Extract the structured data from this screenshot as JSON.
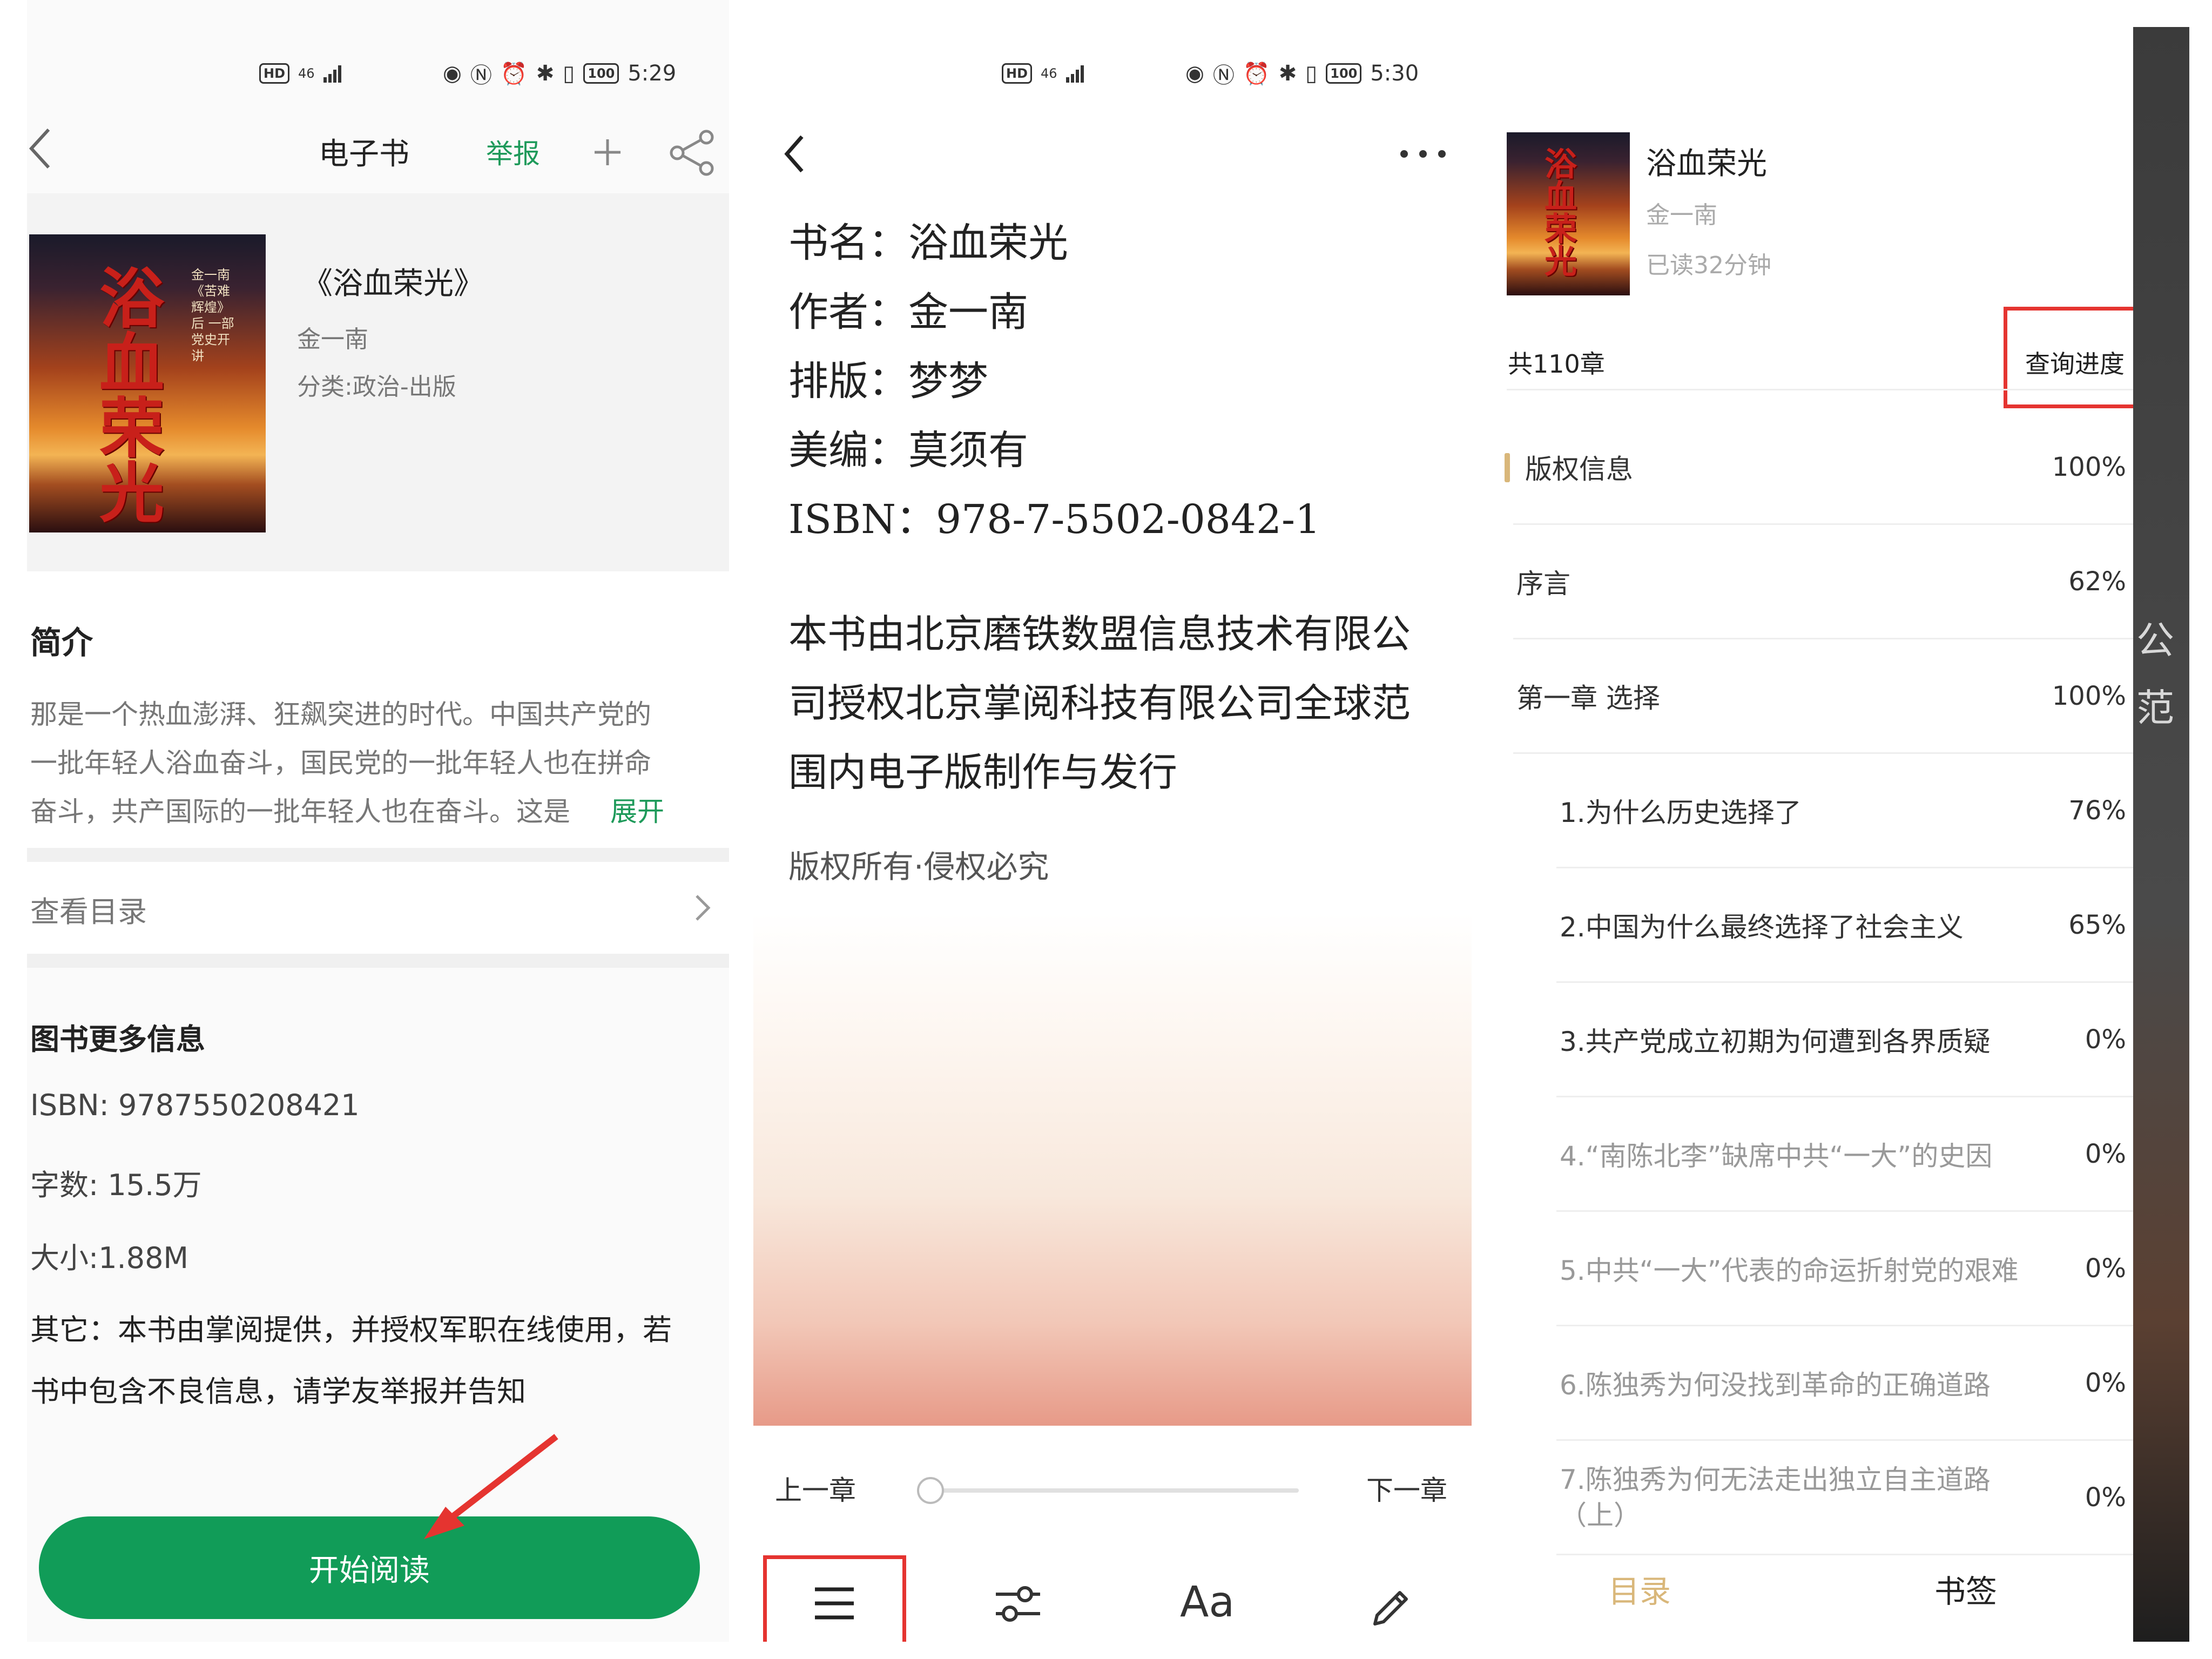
{
  "status_bar_1": {
    "hd": "HD",
    "net": "46",
    "battery": "100",
    "time": "5:29"
  },
  "status_bar_2": {
    "hd": "HD",
    "net": "46",
    "battery": "100",
    "time": "5:30"
  },
  "detail": {
    "title": "电子书",
    "report": "举报",
    "book_title": "《浴血荣光》",
    "author": "金一南",
    "category": "分类:政治-出版",
    "cover_title": "浴血荣光",
    "cover_subtitle": "金一南《苦难辉煌》后 一部党史开讲",
    "intro_heading": "简介",
    "intro_text_1": "那是一个热血澎湃、狂飙突进的时代。中国共产党的",
    "intro_text_2": "一批年轻人浴血奋斗，国民党的一批年轻人也在拼命",
    "intro_text_3": "奋斗，共产国际的一批年轻人也在奋斗。这是",
    "intro_expand": "展开",
    "toc_link": "查看目录",
    "more_heading": "图书更多信息",
    "isbn": "ISBN: 9787550208421",
    "words": "字数: 15.5万",
    "size": "大小:1.88M",
    "other_1": "其它：本书由掌阅提供，并授权军职在线使用，若",
    "other_2": "书中包含不良信息，请学友举报并告知",
    "start_button": "开始阅读"
  },
  "reader": {
    "book_name": "书名：浴血荣光",
    "author": "作者：金一南",
    "typeset": "排版：梦梦",
    "art": "美编：莫须有",
    "isbn": "ISBN：978-7-5502-0842-1",
    "body_1": "本书由北京磨铁数盟信息技术有限公",
    "body_2": "司授权北京掌阅科技有限公司全球范",
    "body_3": "围内电子版制作与发行",
    "rights": "版权所有·侵权必究",
    "prev": "上一章",
    "next": "下一章",
    "font_label": "Aa",
    "progress": 0
  },
  "toc_panel": {
    "book_title": "浴血荣光",
    "author": "金一南",
    "read_time": "已读32分钟",
    "chapter_count": "共110章",
    "query_button": "查询进度",
    "items": [
      {
        "title": "版权信息",
        "pct": "100%"
      },
      {
        "title": "序言",
        "pct": "62%"
      },
      {
        "title": "第一章 选择",
        "pct": "100%"
      },
      {
        "title": "1.为什么历史选择了",
        "pct": "76%"
      },
      {
        "title": "2.中国为什么最终选择了社会主义",
        "pct": "65%"
      },
      {
        "title": "3.共产党成立初期为何遭到各界质疑",
        "pct": "0%"
      },
      {
        "title": "4.“南陈北李”缺席中共“一大”的史因",
        "pct": "0%"
      },
      {
        "title": "5.中共“一大”代表的命运折射党的艰难",
        "pct": "0%"
      },
      {
        "title": "6.陈独秀为何没找到革命的正确道路",
        "pct": "0%"
      },
      {
        "title": "7.陈独秀为何无法走出独立自主道路",
        "title_2": "（上）",
        "pct": "0%"
      }
    ],
    "tab_toc": "目录",
    "tab_bookmark": "书签",
    "strip_text_1": "公",
    "strip_text_2": "范"
  },
  "colors": {
    "accent_green": "#1e9a5a",
    "button_green": "#119c58",
    "highlight_red": "#e53430",
    "tab_gold": "#d9b77a"
  },
  "icons": [
    "back-icon",
    "add-icon",
    "share-icon",
    "chevron-right-icon",
    "more-icon",
    "menu-icon",
    "settings-sliders-icon",
    "font-icon",
    "pen-icon",
    "arrow-annotation"
  ]
}
